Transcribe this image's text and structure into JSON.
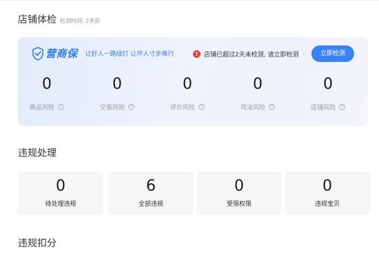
{
  "shop_check": {
    "title": "店铺体检",
    "check_time": "检测时间: 2天前"
  },
  "health_card": {
    "brand_name": "营商保",
    "brand_icon": "shield-check-icon",
    "slogan": "让好人一路绿灯 让坏人寸步难行",
    "warning_icon": "exclamation-icon",
    "warning_text": "店铺已超过2天未检测, 请立即检测",
    "check_button": "立即检测",
    "risks": [
      {
        "value": "0",
        "label": "商品风险"
      },
      {
        "value": "0",
        "label": "交易风险"
      },
      {
        "value": "0",
        "label": "评价风险"
      },
      {
        "value": "0",
        "label": "司法风险"
      },
      {
        "value": "0",
        "label": "店铺风险"
      }
    ]
  },
  "violation": {
    "title": "违规处理",
    "stats": [
      {
        "value": "0",
        "label": "待处理违规"
      },
      {
        "value": "6",
        "label": "全部违规"
      },
      {
        "value": "0",
        "label": "受限权限"
      },
      {
        "value": "0",
        "label": "违规宝贝"
      }
    ]
  },
  "deduction": {
    "title": "违规扣分"
  },
  "colors": {
    "accent": "#3b82f6",
    "warning": "#e5403f",
    "brand": "#2f7ef0"
  }
}
